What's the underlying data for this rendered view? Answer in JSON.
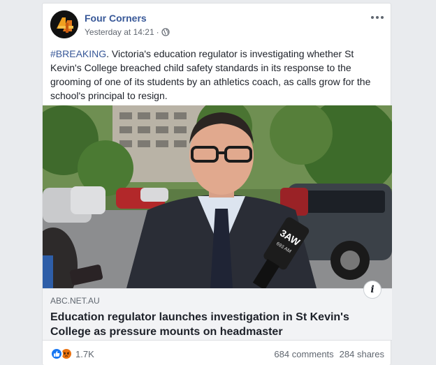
{
  "post": {
    "page_name": "Four Corners",
    "timestamp": "Yesterday at 14:21",
    "separator": "·",
    "hashtag": "#BREAKING",
    "body": ". Victoria's education regulator is investigating whether St Kevin's College breached child safety standards in its response to the grooming of one of its students by an athletics coach, as calls grow for the school's principal to resign."
  },
  "photo": {
    "mic_flag_text": "3AW",
    "mic_flag_subtext": "693 AM"
  },
  "link": {
    "domain": "ABC.NET.AU",
    "title": "Education regulator launches investigation in St Kevin's College as pressure mounts on headmaster",
    "info_icon": "i"
  },
  "footer": {
    "reaction_count": "1.7K",
    "comments": "684 comments",
    "shares": "284 shares"
  },
  "colors": {
    "link_blue": "#385898",
    "like_blue": "#1877f2",
    "angry_orange": "#e9710f"
  }
}
